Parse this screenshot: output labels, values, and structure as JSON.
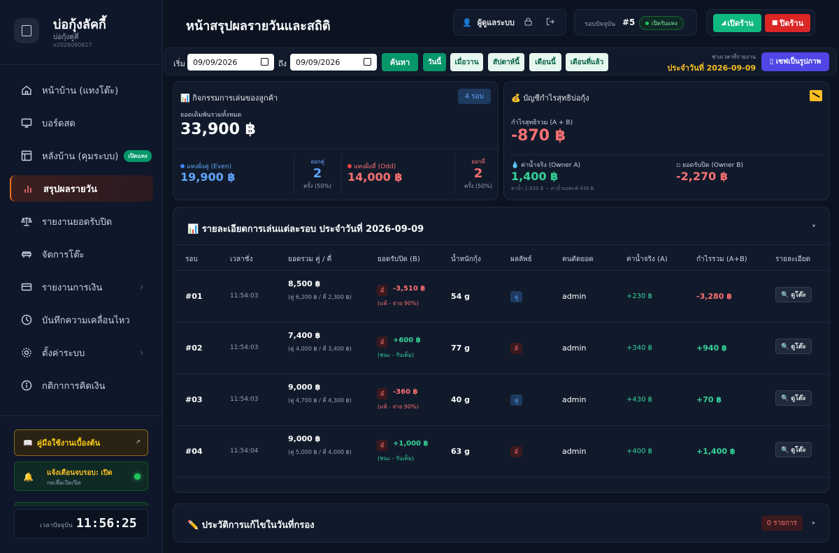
{
  "brand": {
    "title": "บ่อกุ้งลัคกี้",
    "subtitle": "บ่อกุ้งคู่คี่",
    "version": "v2026090817"
  },
  "nav": [
    {
      "label": "หน้าบ้าน (แทงโต๊ะ)",
      "icon": "home-icon",
      "active": false
    },
    {
      "label": "บอร์ดสด",
      "icon": "monitor-icon",
      "active": false
    },
    {
      "label": "หลังบ้าน (คุมระบบ)",
      "icon": "layout-icon",
      "active": false,
      "badge": "เปิดแทง"
    },
    {
      "label": "สรุปผลรายวัน",
      "icon": "bar-chart-icon",
      "active": true
    },
    {
      "label": "รายงานยอดรับปิด",
      "icon": "scale-icon",
      "active": false
    },
    {
      "label": "จัดการโต๊ะ",
      "icon": "table-icon",
      "active": false
    },
    {
      "label": "รายงานการเงิน",
      "icon": "wallet-icon",
      "active": false,
      "chevron": true
    },
    {
      "label": "บันทึกความเคลื่อนไหว",
      "icon": "clock-icon",
      "active": false
    },
    {
      "label": "ตั้งค่าระบบ",
      "icon": "gear-icon",
      "active": false,
      "chevron": true
    },
    {
      "label": "กติกาการคิดเงิน",
      "icon": "info-icon",
      "active": false
    }
  ],
  "sidebar_footer": {
    "guide_label": "คู่มือใช้งานเบื้องต้น",
    "alert_title": "แจ้งเตือนจบรอบ: เปิด",
    "alert_sub": "กดเพื่อเปิด/ปิด",
    "clock_label": "เวลาปัจจุบัน",
    "clock_time": "11:56:25"
  },
  "header": {
    "title": "หน้าสรุปผลรายวันและสถิติ",
    "user_name": "ผู้ดูแลระบบ",
    "round_label": "รอบปัจจุบัน",
    "round_number": "#5",
    "round_status": "เปิดรับแทง",
    "open_label": "เปิดร้าน",
    "close_label": "ปิดร้าน"
  },
  "filter": {
    "start_label": "เริ่ม",
    "start_date": "09/09/2026",
    "end_label": "ถึง",
    "end_date": "09/09/2026",
    "search_label": "ค้นหา",
    "quick": [
      "วันนี้",
      "เมื่อวาน",
      "สัปดาห์นี้",
      "เดือนนี้",
      "เดือนที่แล้ว"
    ],
    "quick_active": 0,
    "range_label": "ช่วงเวลาที่รายงาน",
    "range_value": "ประจำวันที่ 2026-09-09",
    "save_label": "▯ เซฟเป็นรูปภาพ"
  },
  "activity": {
    "title": "📊 กิจกรรมการเล่นของลูกค้า",
    "rounds_chip": "4 รอบ",
    "total_label": "ยอดเดิมพันรวมทั้งหมด",
    "total_value": "33,900 ฿",
    "even_label": "แทงฝั่งคู่ (Even)",
    "even_value": "19,900 ฿",
    "even_count_label": "ออกคู่",
    "even_count": "2",
    "even_count_sub": "ครั้ง (50%)",
    "odd_label": "แทงฝั่งคี่ (Odd)",
    "odd_value": "14,000 ฿",
    "odd_count_label": "ออกคี่",
    "odd_count": "2",
    "odd_count_sub": "ครั้ง (50%)",
    "even_color": "#3b82f6",
    "odd_color": "#ef4444"
  },
  "profit": {
    "title": "💰 บัญชีกำไรสุทธิบ่อกุ้ง",
    "net_label": "กำไรสุทธิรวม (A + B)",
    "net_value": "-870 ฿",
    "water_label": "💧 ค่าน้ำจริง (Owner A)",
    "water_value": "1,400 ฿",
    "water_sub": "ค่าน้ำ 1,830 ฿ − ค่าน้ำยอดแพ้ 430 ฿",
    "close_label": "▫ ยอดรับปิด (Owner B)",
    "close_value": "-2,270 ฿"
  },
  "table": {
    "title": "📊 รายละเอียดการเล่นแต่ละรอบ ประจำวันที่ 2026-09-09",
    "headers": [
      "รอบ",
      "เวลาชั่ง",
      "ยอดรวม คู่ / คี่",
      "ยอดรับปิด (B)",
      "น้ำหนักกุ้ง",
      "ผลลัพธ์",
      "คนตัดยอด",
      "ค่าน้ำจริง (A)",
      "กำไรรวม (A+B)",
      "รายละเอียด"
    ],
    "view_label": "🔍 ดูโต๊ะ",
    "rows": [
      {
        "round": "#01",
        "time": "11:54:03",
        "total": "8,500 ฿",
        "split": "(คู่ 6,200 ฿ / คี่ 2,300 ฿)",
        "badge": "คี่",
        "net": "-3,510 ฿",
        "net_sign": "neg",
        "note": "(แพ้ - จ่าย 90%)",
        "weight": "54 g",
        "result": "คู่",
        "result_type": "even",
        "cutter": "admin",
        "water": "+230 ฿",
        "profit": "-3,280 ฿",
        "profit_sign": "neg"
      },
      {
        "round": "#02",
        "time": "11:54:03",
        "total": "7,400 ฿",
        "split": "(คู่ 4,000 ฿ / คี่ 3,400 ฿)",
        "badge": "คี่",
        "net": "+600 ฿",
        "net_sign": "pos",
        "note": "(ชนะ - รับเต็ม)",
        "weight": "77 g",
        "result": "คี่",
        "result_type": "odd",
        "cutter": "admin",
        "water": "+340 ฿",
        "profit": "+940 ฿",
        "profit_sign": "pos"
      },
      {
        "round": "#03",
        "time": "11:54:03",
        "total": "9,000 ฿",
        "split": "(คู่ 4,700 ฿ / คี่ 4,300 ฿)",
        "badge": "คี่",
        "net": "-360 ฿",
        "net_sign": "neg",
        "note": "(แพ้ - จ่าย 90%)",
        "weight": "40 g",
        "result": "คู่",
        "result_type": "even",
        "cutter": "admin",
        "water": "+430 ฿",
        "profit": "+70 ฿",
        "profit_sign": "pos"
      },
      {
        "round": "#04",
        "time": "11:54:04",
        "total": "9,000 ฿",
        "split": "(คู่ 5,000 ฿ / คี่ 4,000 ฿)",
        "badge": "คี่",
        "net": "+1,000 ฿",
        "net_sign": "pos",
        "note": "(ชนะ - รับเต็ม)",
        "weight": "63 g",
        "result": "คี่",
        "result_type": "odd",
        "cutter": "admin",
        "water": "+400 ฿",
        "profit": "+1,400 ฿",
        "profit_sign": "pos"
      }
    ]
  },
  "history": {
    "title": "✏️ ประวัติการแก้ไขในวันที่กรอง",
    "count": "0 รายการ"
  }
}
